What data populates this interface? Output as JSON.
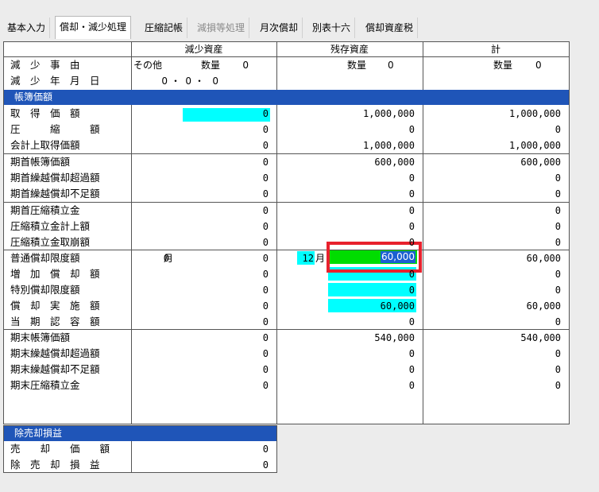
{
  "tabs": [
    {
      "label": "基本入力",
      "state": "normal"
    },
    {
      "label": "償却・減少処理",
      "state": "active"
    },
    {
      "label": "圧縮記帳",
      "state": "normal"
    },
    {
      "label": "減損等処理",
      "state": "disabled"
    },
    {
      "label": "月次償却",
      "state": "normal"
    },
    {
      "label": "別表十六",
      "state": "normal"
    },
    {
      "label": "償却資産税",
      "state": "normal"
    }
  ],
  "columns": {
    "decrease": "減少資産",
    "remaining": "残存資産",
    "total": "計"
  },
  "reduction": {
    "reason_label": "減　少　事　由",
    "reason_value": "その他",
    "qty_label": "数量",
    "qty_value": "0",
    "date_label": "減　少　年　月　日",
    "date_y": "0",
    "date_m": "0",
    "date_d": "0",
    "remaining_qty_label": "数量",
    "remaining_qty_value": "0",
    "total_qty_label": "数量",
    "total_qty_value": "0"
  },
  "section_book": "帳簿価額",
  "rows": [
    {
      "label": "取　得　価　額",
      "dec": "0",
      "rem": "1,000,000",
      "tot": "1,000,000"
    },
    {
      "label": "圧　　　縮　　　額",
      "dec": "0",
      "rem": "0",
      "tot": "0"
    },
    {
      "label": "会計上取得価額",
      "dec": "0",
      "rem": "1,000,000",
      "tot": "1,000,000"
    },
    {
      "label": "期首帳簿価額",
      "dec": "0",
      "rem": "600,000",
      "tot": "600,000"
    },
    {
      "label": "期首繰越償却超過額",
      "dec": "0",
      "rem": "0",
      "tot": "0"
    },
    {
      "label": "期首繰越償却不足額",
      "dec": "0",
      "rem": "0",
      "tot": "0"
    },
    {
      "label": "期首圧縮積立金",
      "dec": "0",
      "rem": "0",
      "tot": "0"
    },
    {
      "label": "圧縮積立金計上額",
      "dec": "0",
      "rem": "0",
      "tot": "0"
    },
    {
      "label": "圧縮積立金取崩額",
      "dec": "0",
      "rem": "0",
      "tot": "0"
    },
    {
      "label": "普通償却限度額",
      "dec": "0",
      "rem": "60,000",
      "tot": "60,000",
      "dec_month": "0",
      "month_unit": "月",
      "rem_month": "12"
    },
    {
      "label": "増　加　償　却　額",
      "dec": "0",
      "rem": "0",
      "tot": "0"
    },
    {
      "label": "特別償却限度額",
      "dec": "0",
      "rem": "0",
      "tot": "0"
    },
    {
      "label": "償　却　実　施　額",
      "dec": "0",
      "rem": "60,000",
      "tot": "60,000"
    },
    {
      "label": "当　期　認　容　額",
      "dec": "0",
      "rem": "0",
      "tot": "0"
    },
    {
      "label": "期末帳簿価額",
      "dec": "0",
      "rem": "540,000",
      "tot": "540,000"
    },
    {
      "label": "期末繰越償却超過額",
      "dec": "0",
      "rem": "0",
      "tot": "0"
    },
    {
      "label": "期末繰越償却不足額",
      "dec": "0",
      "rem": "0",
      "tot": "0"
    },
    {
      "label": "期末圧縮積立金",
      "dec": "0",
      "rem": "0",
      "tot": "0"
    }
  ],
  "section_disposal": "除売却損益",
  "disposal_rows": [
    {
      "label": "売　　却　　価　　額",
      "value": "0"
    },
    {
      "label": "除　売　却　損　益",
      "value": "0"
    }
  ],
  "colors": {
    "section_bar": "#1f55b8",
    "cyan_field": "#00ffff",
    "green_field": "#00dd00",
    "highlight_box": "#e8212d"
  }
}
